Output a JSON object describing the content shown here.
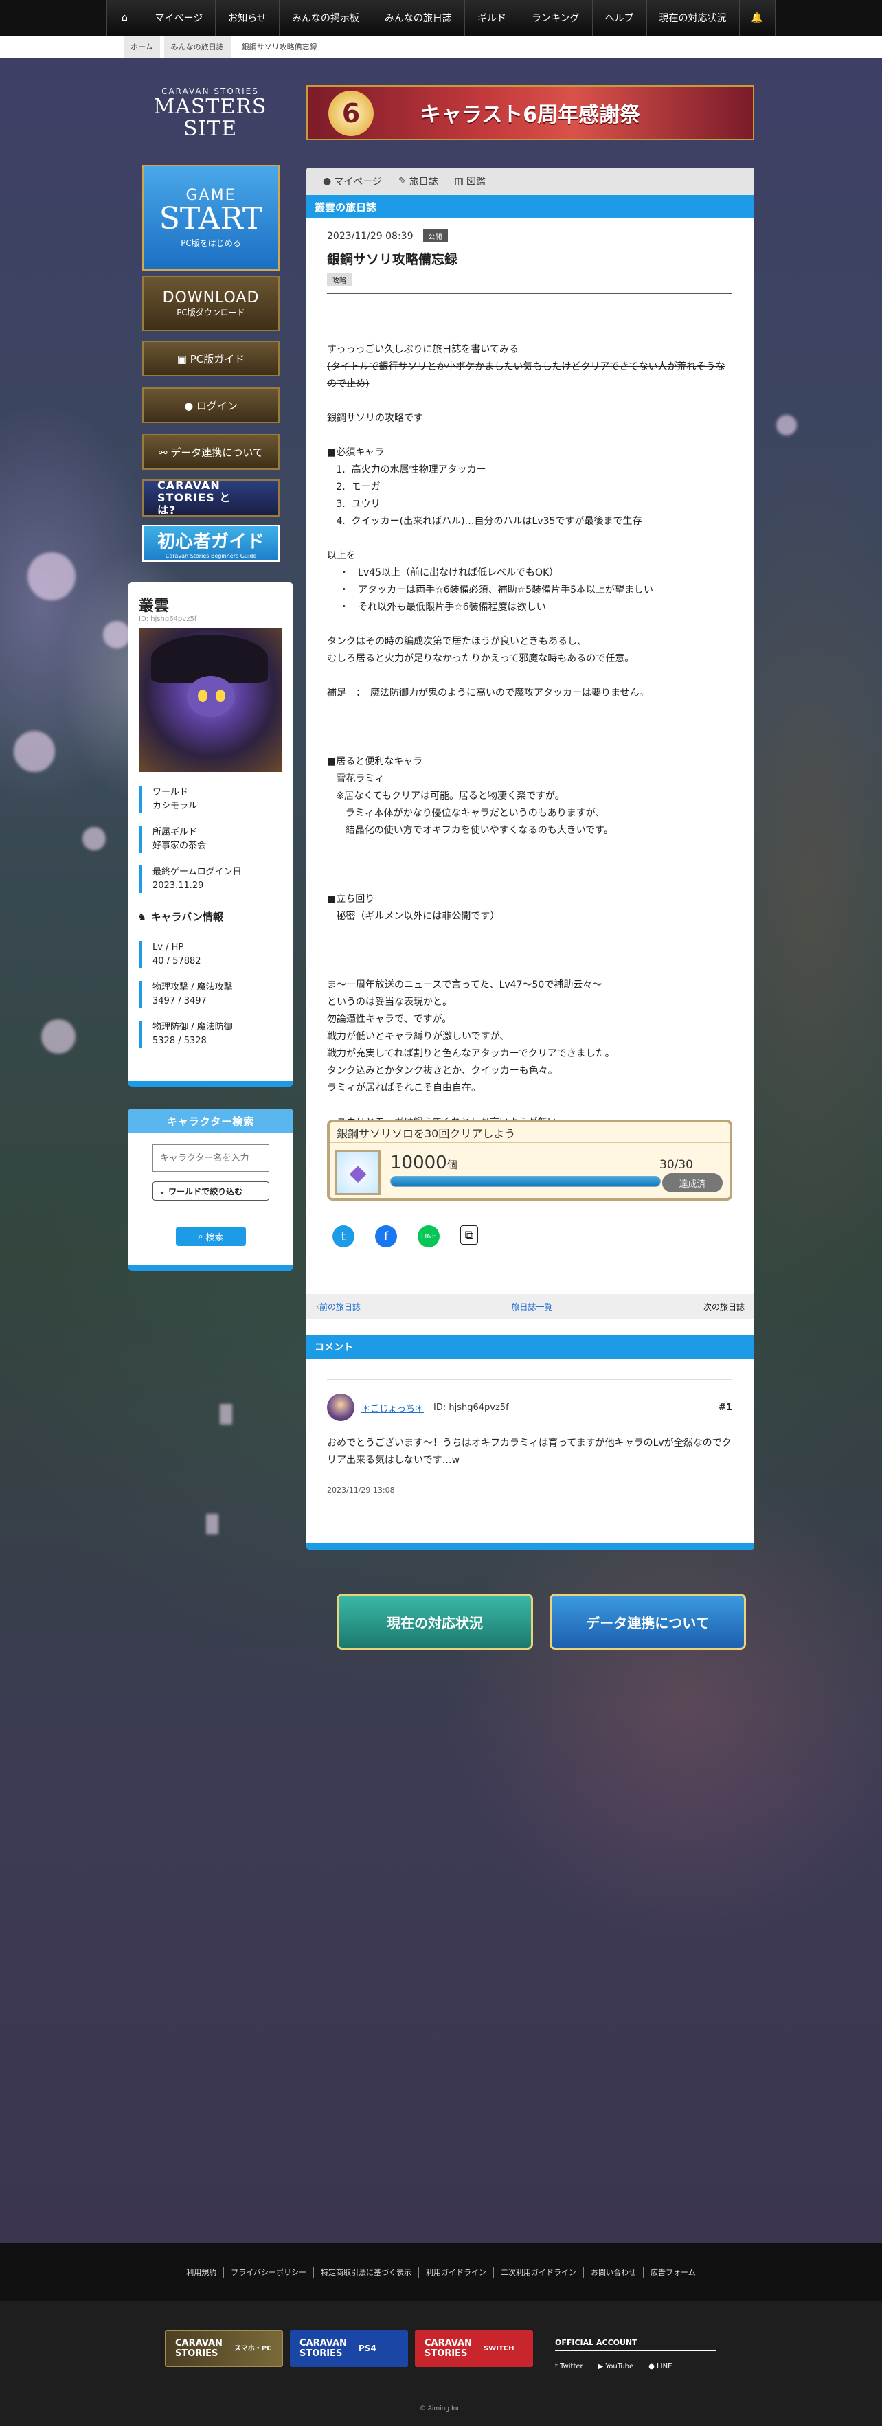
{
  "nav": {
    "items": [
      "マイページ",
      "お知らせ",
      "みんなの掲示板",
      "みんなの旅日誌",
      "ギルド",
      "ランキング",
      "ヘルプ",
      "現在の対応状況"
    ]
  },
  "breadcrumb": [
    "ホーム",
    "みんなの旅日誌",
    "銀鋼サソリ攻略備忘録"
  ],
  "logo": {
    "line1": "CARAVAN STORIES",
    "line2": "MASTERS SITE"
  },
  "banner": {
    "num": "6",
    "text": "キャラスト6周年感謝祭"
  },
  "sidebar": {
    "game_start": {
      "t1": "GAME",
      "t2": "START",
      "t3": "PC版をはじめる"
    },
    "download": {
      "t1": "DOWNLOAD",
      "t2": "PC版ダウンロード"
    },
    "pc_guide": "PC版ガイド",
    "login": "ログイン",
    "data_link": "データ連携について",
    "cs": "CARAVAN STORIES とは?",
    "beginner": {
      "t1": "初心者ガイド",
      "t2": "Caravan Stories Beginners Guide"
    }
  },
  "profile": {
    "name": "叢雲",
    "id": "ID: hjshg64pvz5f",
    "world_label": "ワールド",
    "world": "カシモラル",
    "guild_label": "所属ギルド",
    "guild": "好事家の茶会",
    "login_label": "最終ゲームログイン日",
    "login": "2023.11.29",
    "caravan": "キャラバン情報",
    "lvhp_label": "Lv / HP",
    "lvhp": "40 / 57882",
    "atk_label": "物理攻撃 / 魔法攻撃",
    "atk": "3497 / 3497",
    "def_label": "物理防御 / 魔法防御",
    "def": "5328 / 5328"
  },
  "search": {
    "title": "キャラクター検索",
    "placeholder": "キャラクター名を入力",
    "filter": "ワールドで絞り込む",
    "button": "検索"
  },
  "tabs": [
    "マイページ",
    "旅日誌",
    "図鑑"
  ],
  "panel_title": "叢雲の旅日誌",
  "article": {
    "date": "2023/11/29 08:39",
    "status": "公開",
    "title": "銀鋼サソリ攻略備忘録",
    "tag": "攻略",
    "lines": [
      "",
      "すっっっごい久しぶりに旅日誌を書いてみる",
      "(タイトルで銀行サソリとか小ボケかましたい気もしたけどクリアできてない人が荒れそうなので止め)",
      "",
      "銀鋼サソリの攻略です",
      "",
      "■必須キャラ",
      "   1.  高火力の水属性物理アタッカー",
      "   2.  モーガ",
      "   3.  ユウリ",
      "   4.  クイッカー(出来ればハル)…自分のハルはLv35ですが最後まで生存",
      "",
      "以上を",
      "    ・   Lv45以上（前に出なければ低レベルでもOK）",
      "    ・   アタッカーは両手☆6装備必須、補助☆5装備片手5本以上が望ましい",
      "    ・   それ以外も最低限片手☆6装備程度は欲しい",
      "",
      "タンクはその時の編成次第で居たほうが良いときもあるし、",
      "むしろ居ると火力が足りなかったりかえって邪魔な時もあるので任意。",
      "",
      "補足　：　魔法防御力が鬼のように高いので魔攻アタッカーは要りません。",
      "",
      "",
      "",
      "■居ると便利なキャラ",
      "   雪花ラミィ",
      "   ※居なくてもクリアは可能。居ると物凄く楽ですが。",
      "      ラミィ本体がかなり優位なキャラだというのもありますが、",
      "      結晶化の使い方でオキフカを使いやすくなるのも大きいです。",
      "",
      "",
      "",
      "■立ち回り",
      "   秘密（ギルメン以外には非公開です）",
      "",
      "",
      "",
      "ま～一周年放送のニュースで言ってた、Lv47～50で補助云々～",
      "というのは妥当な表現かと。",
      "勿論適性キャラで、ですが。",
      "戦力が低いとキャラ縛りが激しいですが、",
      "戦力が充実してれば割りと色んなアタッカーでクリアできました。",
      "タンク込みとかタンク抜きとか、クイッカーも色々。",
      "ラミィが居ればそれこそ自由自在。",
      "",
      "…ユウリとモーガは鍛えてくれとしか言いようが無い…"
    ]
  },
  "quest": {
    "title": "銀鋼サソリソロを30回クリアしよう",
    "reward": "10000",
    "unit": "個",
    "progress": "30/30",
    "fraction": 1.0,
    "done": "達成済"
  },
  "share": {
    "twitter": "twitter-icon",
    "facebook": "facebook-icon",
    "line": "line-icon",
    "copy": "copy-icon"
  },
  "pager": {
    "prev": "前の旅日誌",
    "list": "旅日誌一覧",
    "next": "次の旅日誌"
  },
  "comments": {
    "title": "コメント",
    "items": [
      {
        "name": "＊ごじょっち＊",
        "id": "ID: hjshg64pvz5f",
        "num": "#1",
        "text": "おめでとうございます〜！うちはオキフカラミィは育ってますが他キャラのLvが全然なのでクリア出来る気はしないです…w",
        "date": "2023/11/29 13:08"
      }
    ]
  },
  "bottom": {
    "status": "現在の対応状況",
    "data": "データ連携について"
  },
  "footer": {
    "links": [
      "利用規約",
      "プライバシーポリシー",
      "特定商取引法に基づく表示",
      "利用ガイドライン",
      "二次利用ガイドライン",
      "お問い合わせ",
      "広告フォーム"
    ],
    "platforms": [
      {
        "name": "CARAVAN STORIES",
        "sub": "スマホ・PC"
      },
      {
        "name": "CARAVAN STORIES",
        "sub": "PS4"
      },
      {
        "name": "CARAVAN STORIES",
        "sub": "SWITCH"
      }
    ],
    "official": "OFFICIAL ACCOUNT",
    "socials": [
      "Twitter",
      "YouTube",
      "LINE"
    ],
    "copyright": "© Aiming Inc."
  },
  "colors": {
    "accent": "#1d9be6",
    "nav": "#111111"
  }
}
